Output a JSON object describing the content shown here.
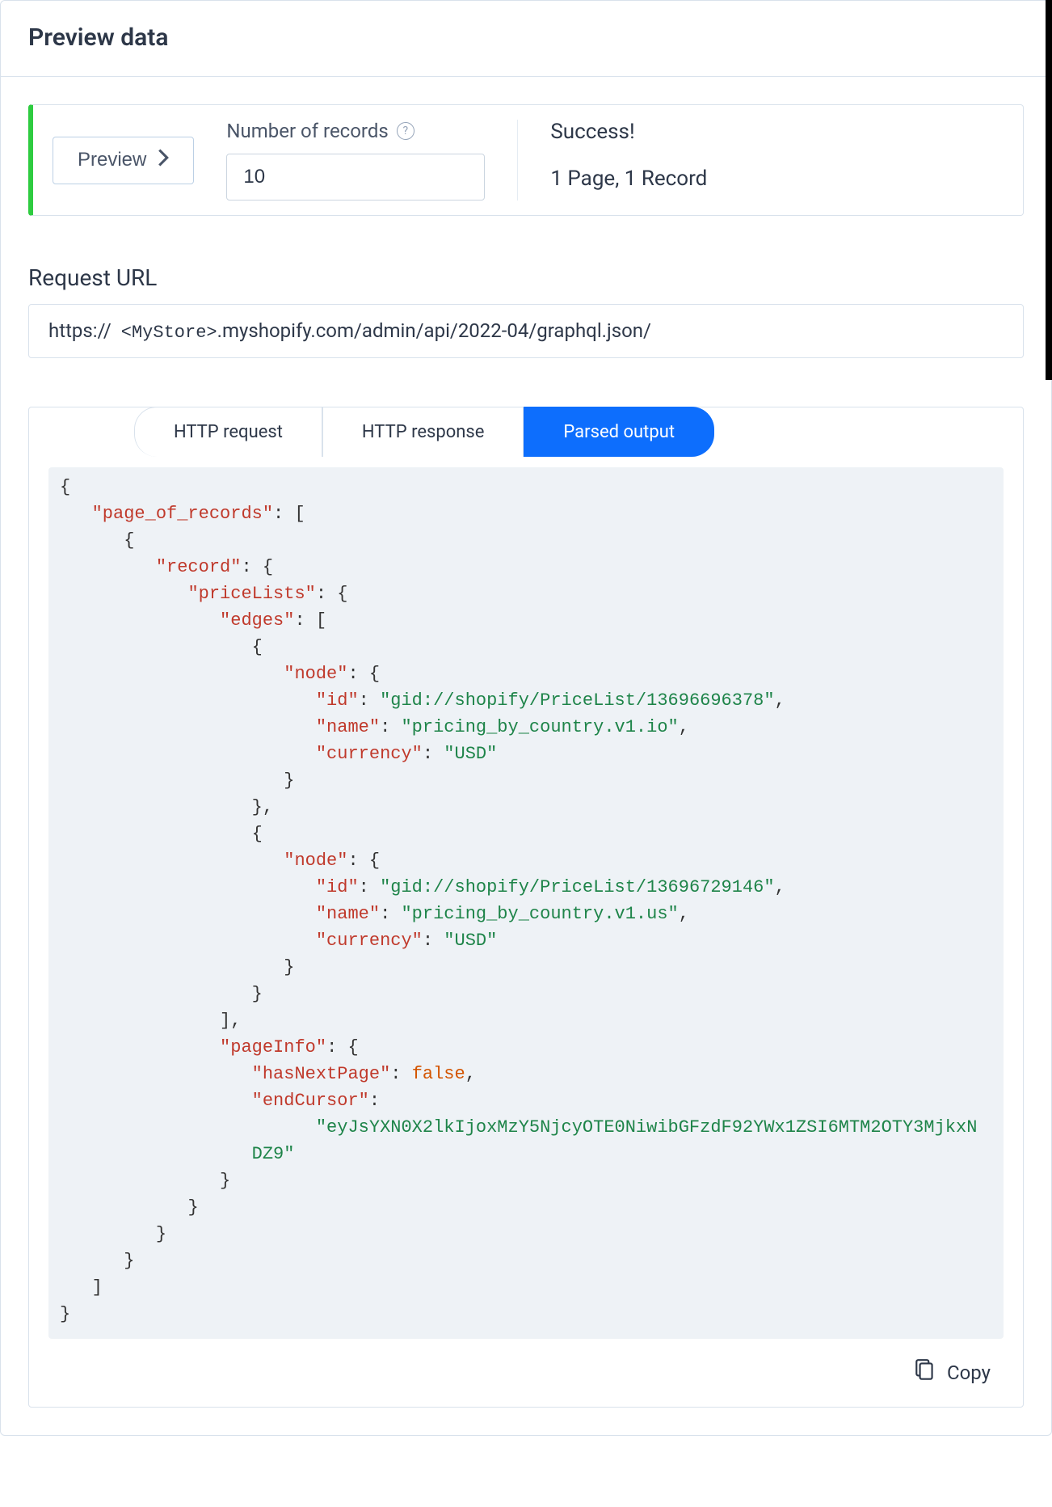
{
  "section_title": "Preview data",
  "preview_button": "Preview",
  "records": {
    "label": "Number of records",
    "value": "10"
  },
  "status": {
    "title": "Success!",
    "detail": "1 Page, 1 Record"
  },
  "request_url": {
    "label": "Request URL",
    "prefix": "https://",
    "variable": "<MyStore>",
    "path": ".myshopify.com/admin/api/2022-04/graphql.json/"
  },
  "tabs": {
    "http_request": "HTTP request",
    "http_response": "HTTP response",
    "parsed_output": "Parsed output"
  },
  "copy_label": "Copy",
  "json_tokens": [
    {
      "t": "p",
      "v": "{"
    },
    {
      "t": "nl"
    },
    {
      "t": "in",
      "n": 1
    },
    {
      "t": "k",
      "v": "\"page_of_records\""
    },
    {
      "t": "p",
      "v": ": ["
    },
    {
      "t": "nl"
    },
    {
      "t": "in",
      "n": 2
    },
    {
      "t": "p",
      "v": "{"
    },
    {
      "t": "nl"
    },
    {
      "t": "in",
      "n": 3
    },
    {
      "t": "k",
      "v": "\"record\""
    },
    {
      "t": "p",
      "v": ": {"
    },
    {
      "t": "nl"
    },
    {
      "t": "in",
      "n": 4
    },
    {
      "t": "k",
      "v": "\"priceLists\""
    },
    {
      "t": "p",
      "v": ": {"
    },
    {
      "t": "nl"
    },
    {
      "t": "in",
      "n": 5
    },
    {
      "t": "k",
      "v": "\"edges\""
    },
    {
      "t": "p",
      "v": ": ["
    },
    {
      "t": "nl"
    },
    {
      "t": "in",
      "n": 6
    },
    {
      "t": "p",
      "v": "{"
    },
    {
      "t": "nl"
    },
    {
      "t": "in",
      "n": 7
    },
    {
      "t": "k",
      "v": "\"node\""
    },
    {
      "t": "p",
      "v": ": {"
    },
    {
      "t": "nl"
    },
    {
      "t": "in",
      "n": 8
    },
    {
      "t": "k",
      "v": "\"id\""
    },
    {
      "t": "p",
      "v": ": "
    },
    {
      "t": "s",
      "v": "\"gid://shopify/PriceList/13696696378\""
    },
    {
      "t": "p",
      "v": ","
    },
    {
      "t": "nl"
    },
    {
      "t": "in",
      "n": 8
    },
    {
      "t": "k",
      "v": "\"name\""
    },
    {
      "t": "p",
      "v": ": "
    },
    {
      "t": "s",
      "v": "\"pricing_by_country.v1.io\""
    },
    {
      "t": "p",
      "v": ","
    },
    {
      "t": "nl"
    },
    {
      "t": "in",
      "n": 8
    },
    {
      "t": "k",
      "v": "\"currency\""
    },
    {
      "t": "p",
      "v": ": "
    },
    {
      "t": "s",
      "v": "\"USD\""
    },
    {
      "t": "nl"
    },
    {
      "t": "in",
      "n": 7
    },
    {
      "t": "p",
      "v": "}"
    },
    {
      "t": "nl"
    },
    {
      "t": "in",
      "n": 6
    },
    {
      "t": "p",
      "v": "},"
    },
    {
      "t": "nl"
    },
    {
      "t": "in",
      "n": 6
    },
    {
      "t": "p",
      "v": "{"
    },
    {
      "t": "nl"
    },
    {
      "t": "in",
      "n": 7
    },
    {
      "t": "k",
      "v": "\"node\""
    },
    {
      "t": "p",
      "v": ": {"
    },
    {
      "t": "nl"
    },
    {
      "t": "in",
      "n": 8
    },
    {
      "t": "k",
      "v": "\"id\""
    },
    {
      "t": "p",
      "v": ": "
    },
    {
      "t": "s",
      "v": "\"gid://shopify/PriceList/13696729146\""
    },
    {
      "t": "p",
      "v": ","
    },
    {
      "t": "nl"
    },
    {
      "t": "in",
      "n": 8
    },
    {
      "t": "k",
      "v": "\"name\""
    },
    {
      "t": "p",
      "v": ": "
    },
    {
      "t": "s",
      "v": "\"pricing_by_country.v1.us\""
    },
    {
      "t": "p",
      "v": ","
    },
    {
      "t": "nl"
    },
    {
      "t": "in",
      "n": 8
    },
    {
      "t": "k",
      "v": "\"currency\""
    },
    {
      "t": "p",
      "v": ": "
    },
    {
      "t": "s",
      "v": "\"USD\""
    },
    {
      "t": "nl"
    },
    {
      "t": "in",
      "n": 7
    },
    {
      "t": "p",
      "v": "}"
    },
    {
      "t": "nl"
    },
    {
      "t": "in",
      "n": 6
    },
    {
      "t": "p",
      "v": "}"
    },
    {
      "t": "nl"
    },
    {
      "t": "in",
      "n": 5
    },
    {
      "t": "p",
      "v": "],"
    },
    {
      "t": "nl"
    },
    {
      "t": "in",
      "n": 5
    },
    {
      "t": "k",
      "v": "\"pageInfo\""
    },
    {
      "t": "p",
      "v": ": {"
    },
    {
      "t": "nl"
    },
    {
      "t": "in",
      "n": 6
    },
    {
      "t": "k",
      "v": "\"hasNextPage\""
    },
    {
      "t": "p",
      "v": ": "
    },
    {
      "t": "b",
      "v": "false"
    },
    {
      "t": "p",
      "v": ","
    },
    {
      "t": "nl"
    },
    {
      "t": "in",
      "n": 6
    },
    {
      "t": "k",
      "v": "\"endCursor\""
    },
    {
      "t": "p",
      "v": ":"
    },
    {
      "t": "nl"
    },
    {
      "t": "in",
      "n": 8
    },
    {
      "t": "s",
      "v": "\"eyJsYXN0X2lkIjoxMzY5NjcyOTE0NiwibGFzdF92YWx1ZSI6MTM2OTY3MjkxN\n                  DZ9\""
    },
    {
      "t": "nl"
    },
    {
      "t": "in",
      "n": 5
    },
    {
      "t": "p",
      "v": "}"
    },
    {
      "t": "nl"
    },
    {
      "t": "in",
      "n": 4
    },
    {
      "t": "p",
      "v": "}"
    },
    {
      "t": "nl"
    },
    {
      "t": "in",
      "n": 3
    },
    {
      "t": "p",
      "v": "}"
    },
    {
      "t": "nl"
    },
    {
      "t": "in",
      "n": 2
    },
    {
      "t": "p",
      "v": "}"
    },
    {
      "t": "nl"
    },
    {
      "t": "in",
      "n": 1
    },
    {
      "t": "p",
      "v": "]"
    },
    {
      "t": "nl"
    },
    {
      "t": "p",
      "v": "}"
    }
  ]
}
